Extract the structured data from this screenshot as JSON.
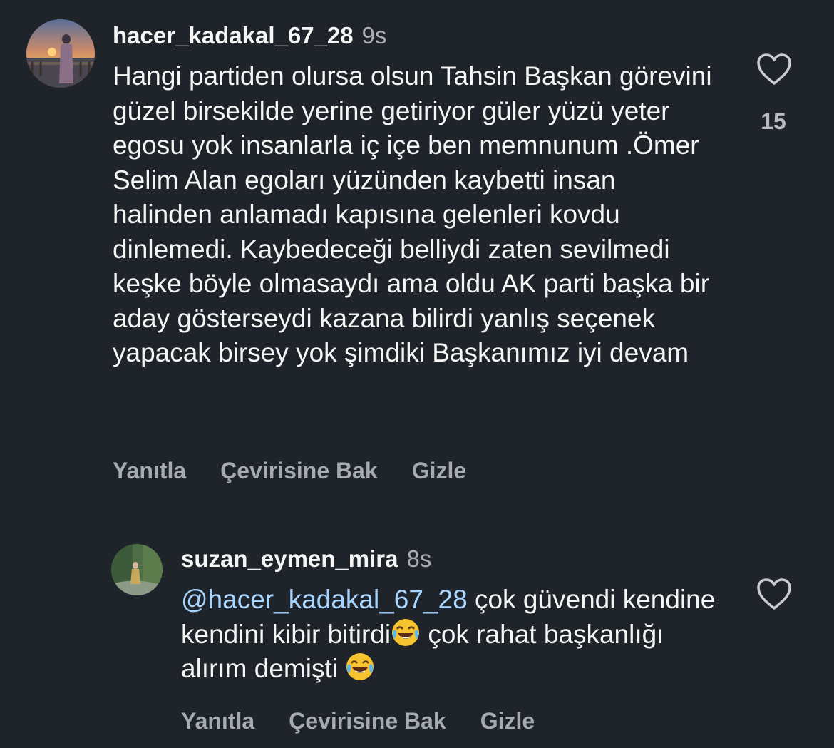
{
  "comments": [
    {
      "username": "hacer_kadakal_67_28",
      "time": "9s",
      "text": "Hangi partiden olursa olsun Tahsin Başkan görevini güzel birsekilde yerine getiriyor güler yüzü yeter egosu yok insanlarla iç içe ben memnunum .Ömer Selim Alan egoları yüzünden kaybetti insan halinden anlamadı kapısına gelenleri kovdu dinlemedi. Kaybedeceği belliydi zaten sevilmedi keşke böyle olmasaydı ama oldu AK parti başka bir aday gösterseydi kazana bilirdi yanlış seçenek yapacak birsey yok şimdiki Başkanımız iyi devam",
      "likes": "15",
      "actions": {
        "reply": "Yanıtla",
        "translate": "Çevirisine Bak",
        "hide": "Gizle"
      }
    },
    {
      "username": "suzan_eymen_mira",
      "time": "8s",
      "mention": "@hacer_kadakal_67_28",
      "text_1": " çok güvendi kendine kendini kibir bitirdi",
      "text_2": " çok rahat başkanlığı alırım demişti ",
      "actions": {
        "reply": "Yanıtla",
        "translate": "Çevirisine Bak",
        "hide": "Gizle"
      }
    }
  ],
  "icons": {
    "like": "heart-outline-icon",
    "emoji": "face-with-tears-of-joy-emoji"
  },
  "colors": {
    "background": "#1f232a",
    "mention": "#a8d5ff",
    "secondary_text": "#a6abb2"
  }
}
